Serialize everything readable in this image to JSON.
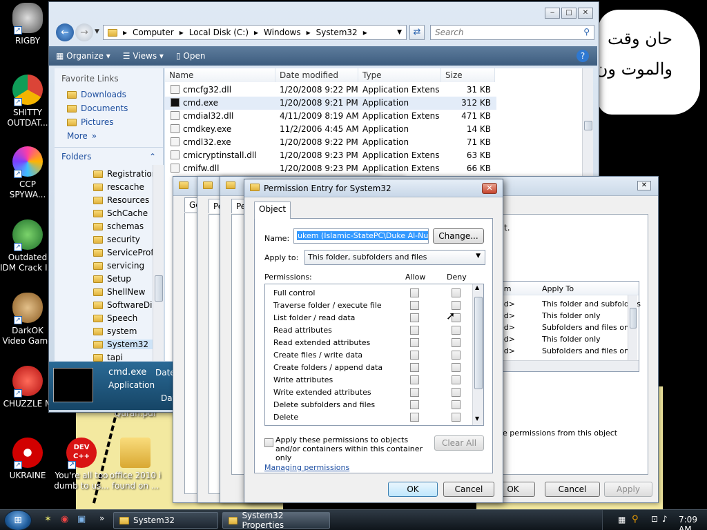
{
  "desktop": {
    "arabic_line1": "حان وقت",
    "arabic_line2": "والموت ون",
    "icons": [
      {
        "label": "RIGBY"
      },
      {
        "label": "SHITTY OUTDAT..."
      },
      {
        "label": "CCP SPYWA..."
      },
      {
        "label": "Outdated IDM Crack I..."
      },
      {
        "label": "DarkOK Video Game"
      },
      {
        "label": "CHUZZLE M"
      },
      {
        "label": "UKRAINE"
      },
      {
        "label": "You're all too dumb to us..."
      },
      {
        "label": "office 2010 i found on ..."
      },
      {
        "label": "Quran.pdf"
      }
    ],
    "dev_label": "DEV C++"
  },
  "explorer": {
    "breadcrumb": [
      "Computer",
      "Local Disk (C:)",
      "Windows",
      "System32"
    ],
    "search_placeholder": "Search",
    "toolbar": {
      "organize": "Organize",
      "views": "Views",
      "open": "Open"
    },
    "favorites_header": "Favorite Links",
    "favorites": [
      "Downloads",
      "Documents",
      "Pictures"
    ],
    "more": "More",
    "folders_header": "Folders",
    "tree": [
      "Registration",
      "rescache",
      "Resources",
      "SchCache",
      "schemas",
      "security",
      "ServiceProfile",
      "servicing",
      "Setup",
      "ShellNew",
      "SoftwareDist",
      "Speech",
      "system",
      "System32",
      "tapi"
    ],
    "columns": {
      "name": "Name",
      "date": "Date modified",
      "type": "Type",
      "size": "Size"
    },
    "files": [
      {
        "name": "cmcfg32.dll",
        "date": "1/20/2008 9:22 PM",
        "type": "Application Extens...",
        "size": "31 KB"
      },
      {
        "name": "cmd.exe",
        "date": "1/20/2008 9:21 PM",
        "type": "Application",
        "size": "312 KB"
      },
      {
        "name": "cmdial32.dll",
        "date": "4/11/2009 8:19 AM",
        "type": "Application Extens...",
        "size": "471 KB"
      },
      {
        "name": "cmdkey.exe",
        "date": "11/2/2006 4:45 AM",
        "type": "Application",
        "size": "14 KB"
      },
      {
        "name": "cmdl32.exe",
        "date": "1/20/2008 9:22 PM",
        "type": "Application",
        "size": "71 KB"
      },
      {
        "name": "cmicryptinstall.dll",
        "date": "1/20/2008 9:23 PM",
        "type": "Application Extens...",
        "size": "63 KB"
      },
      {
        "name": "cmifw.dll",
        "date": "1/20/2008 9:23 PM",
        "type": "Application Extens...",
        "size": "66 KB"
      }
    ],
    "details": {
      "name": "cmd.exe",
      "type": "Application",
      "date_label": "Date",
      "date_label2": "Dat"
    }
  },
  "back_dialogs": {
    "tab_ge": "Ge",
    "tab_pe": "Pe",
    "apply_to_header": "Apply To",
    "from_header": "om",
    "rows": [
      {
        "from": "ed>",
        "apply": "This folder and subfolders"
      },
      {
        "from": "ed>",
        "apply": "This folder only"
      },
      {
        "from": "ed>",
        "apply": "Subfolders and files only"
      },
      {
        "from": "ed>",
        "apply": "This folder only"
      },
      {
        "from": "ed>",
        "apply": "Subfolders and files only"
      }
    ],
    "inherit_text": "e permissions from this object",
    "ok": "OK",
    "cancel": "Cancel",
    "apply": "Apply",
    "dot": "t."
  },
  "perm_dialog": {
    "title": "Permission Entry for System32",
    "tab": "Object",
    "name_label": "Name:",
    "name_value": "ukem (Islamic-StatePC\\Duke Al-Nukem)",
    "change_btn": "Change...",
    "apply_label": "Apply to:",
    "apply_value": "This folder, subfolders and files",
    "permissions_label": "Permissions:",
    "allow": "Allow",
    "deny": "Deny",
    "permissions": [
      "Full control",
      "Traverse folder / execute file",
      "List folder / read data",
      "Read attributes",
      "Read extended attributes",
      "Create files / write data",
      "Create folders / append data",
      "Write attributes",
      "Write extended attributes",
      "Delete subfolders and files",
      "Delete"
    ],
    "apply_check": "Apply these permissions to objects and/or containers within this container only",
    "clear_all": "Clear All",
    "managing": "Managing permissions",
    "ok": "OK",
    "cancel": "Cancel"
  },
  "taskbar": {
    "tasks": [
      "System32",
      "System32 Properties"
    ],
    "clock": "7:09 AM"
  }
}
